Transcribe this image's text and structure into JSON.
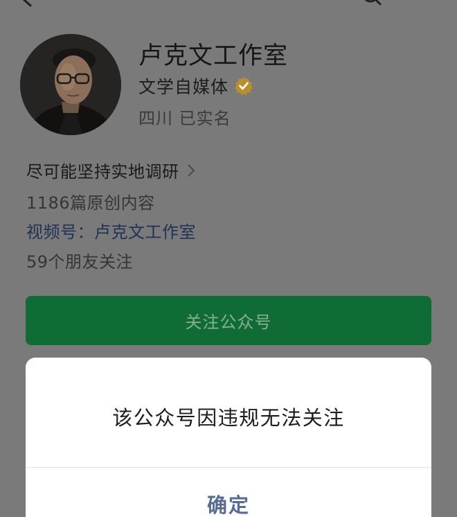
{
  "profile": {
    "name": "卢克文工作室",
    "category": "文学自媒体",
    "location": "四川 已实名",
    "avatar_icon": "person-with-glasses-avatar"
  },
  "info": {
    "description": "尽可能坚持实地调研",
    "articles": "1186篇原创内容",
    "channels": "视频号：卢克文工作室",
    "friends": "59个朋友关注"
  },
  "actions": {
    "follow_label": "关注公众号"
  },
  "dialog": {
    "message": "该公众号因违规无法关注",
    "confirm_label": "确定"
  },
  "colors": {
    "dim_background": "#7a7a7a",
    "follow_button": "#0f6c35",
    "dialog_confirm": "#576b95",
    "verified_badge": "#b8902a",
    "link_text": "#223253"
  },
  "icons": {
    "back": "back-arrow-icon",
    "search": "search-icon",
    "verified": "verified-badge-icon",
    "chevron": "chevron-right-icon"
  }
}
